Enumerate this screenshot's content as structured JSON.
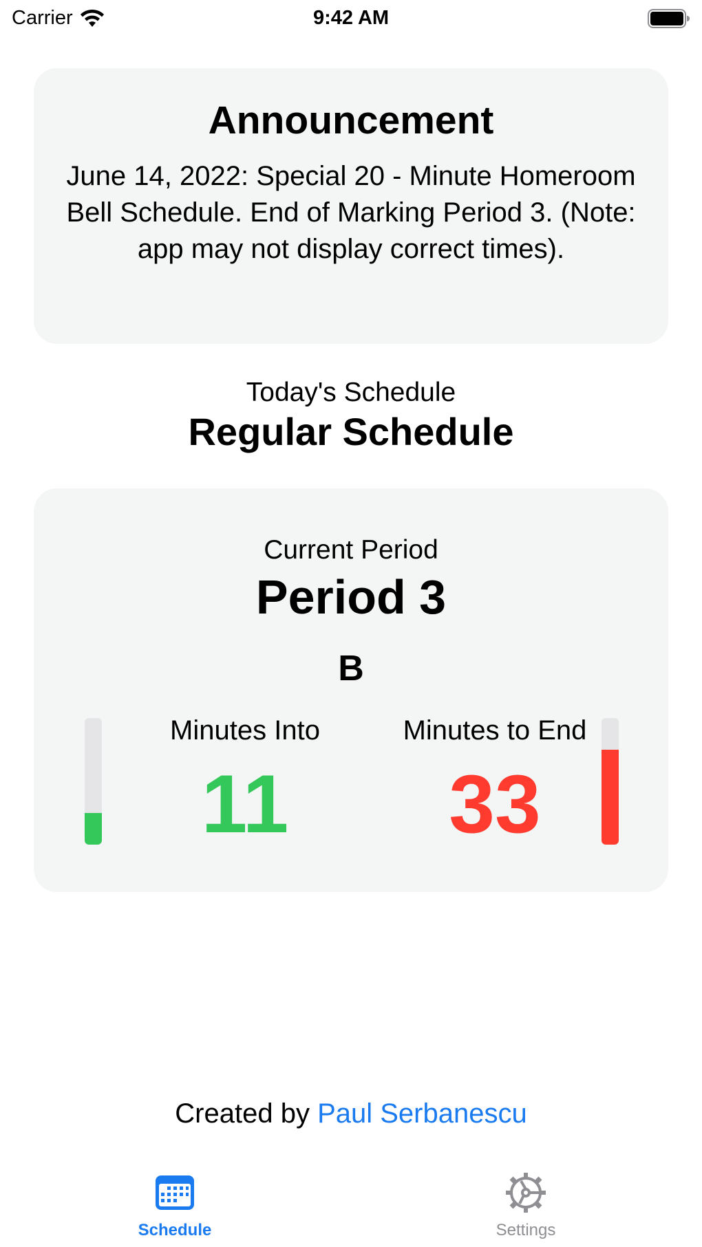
{
  "status_bar": {
    "carrier": "Carrier",
    "time": "9:42 AM"
  },
  "announcement": {
    "title": "Announcement",
    "body": "June 14, 2022: Special 20 - Minute Homeroom Bell Schedule. End of Marking Period 3. (Note: app may not display correct times)."
  },
  "schedule": {
    "subtitle": "Today's Schedule",
    "name": "Regular Schedule"
  },
  "current_period": {
    "label": "Current Period",
    "name": "Period 3",
    "day": "B",
    "minutes_into_label": "Minutes Into",
    "minutes_into": "11",
    "minutes_to_end_label": "Minutes to End",
    "minutes_to_end": "33",
    "into_fraction": 0.25,
    "end_fraction": 0.75
  },
  "credit": {
    "prefix": "Created by ",
    "author": "Paul Serbanescu"
  },
  "tabs": [
    {
      "label": "Schedule",
      "icon": "calendar-icon",
      "selected": true
    },
    {
      "label": "Settings",
      "icon": "gear-icon",
      "selected": false
    }
  ],
  "colors": {
    "accent": "#1a7bf0",
    "green": "#34c759",
    "red": "#ff3b30",
    "card_bg": "#f4f5f5",
    "bar_track": "#e5e5e7",
    "inactive_tab": "#8e8e93"
  }
}
